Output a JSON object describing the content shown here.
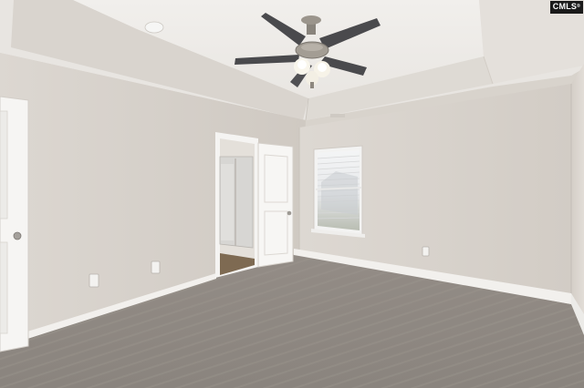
{
  "watermark": {
    "text": "CMLS",
    "mark": "®"
  }
}
